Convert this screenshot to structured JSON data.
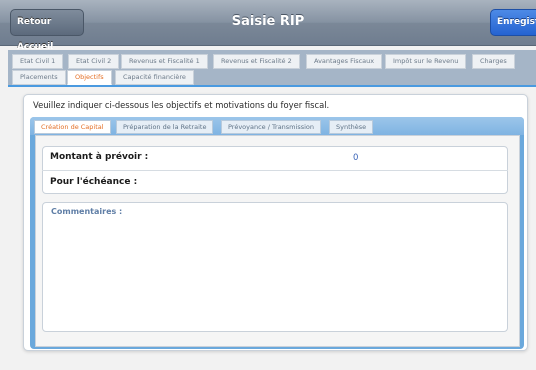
{
  "navbar": {
    "title": "Saisie RIP",
    "back_label": "Retour Accueil",
    "save_label": "Enregistre"
  },
  "main_tabs": [
    {
      "label": "Etat Civil 1",
      "active": false
    },
    {
      "label": "Etat Civil 2",
      "active": false
    },
    {
      "label": "Revenus et Fiscalité 1",
      "active": false
    },
    {
      "label": "Revenus et Fiscalité 2",
      "active": false
    },
    {
      "label": "Avantages Fiscaux",
      "active": false
    },
    {
      "label": "Impôt sur le Revenu",
      "active": false
    },
    {
      "label": "Charges",
      "active": false
    },
    {
      "label": "Placements",
      "active": false
    },
    {
      "label": "Objectifs",
      "active": true
    },
    {
      "label": "Capacité financière",
      "active": false
    }
  ],
  "instruction": "Veuillez indiquer ci-dessous les objectifs et motivations du foyer fiscal.",
  "sub_tabs": [
    {
      "label": "Création de Capital",
      "active": true
    },
    {
      "label": "Préparation de la Retraite",
      "active": false
    },
    {
      "label": "Prévoyance / Transmission",
      "active": false
    },
    {
      "label": "Synthèse",
      "active": false
    }
  ],
  "fields": {
    "montant_label": "Montant à prévoir :",
    "montant_value": "0",
    "echeance_label": "Pour l'échéance :"
  },
  "comments": {
    "label": "Commentaires :"
  },
  "colors": {
    "accent_orange": "#e46f25",
    "blue_band": "#6aa8dc",
    "save_blue": "#2563d1"
  }
}
